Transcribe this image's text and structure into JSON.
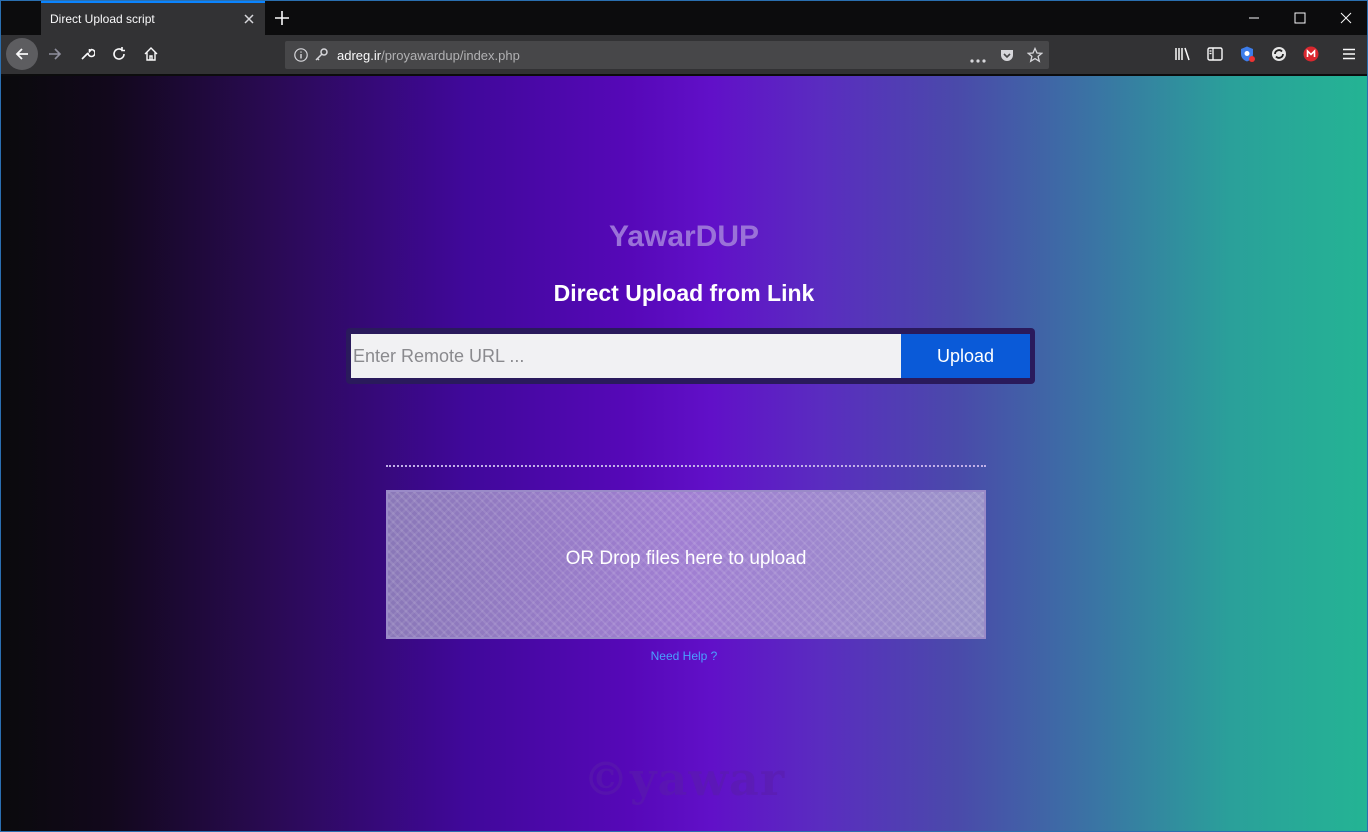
{
  "browser": {
    "tab": {
      "title": "Direct Upload script"
    },
    "url": {
      "host": "adreg.ir",
      "path": "/proyawardup/index.php"
    }
  },
  "page": {
    "brand": "YawarDUP",
    "headline": "Direct Upload from Link",
    "form": {
      "placeholder": "Enter Remote URL ...",
      "button_label": "Upload"
    },
    "dropzone_text": "OR Drop files here to upload",
    "help_link": "Need Help ?",
    "footer_logo": "©yawar"
  },
  "colors": {
    "accent": "#0a5ad8",
    "tab_indicator": "#0a84ff",
    "brand": "#9a72d8",
    "link": "#4aa0ff"
  }
}
